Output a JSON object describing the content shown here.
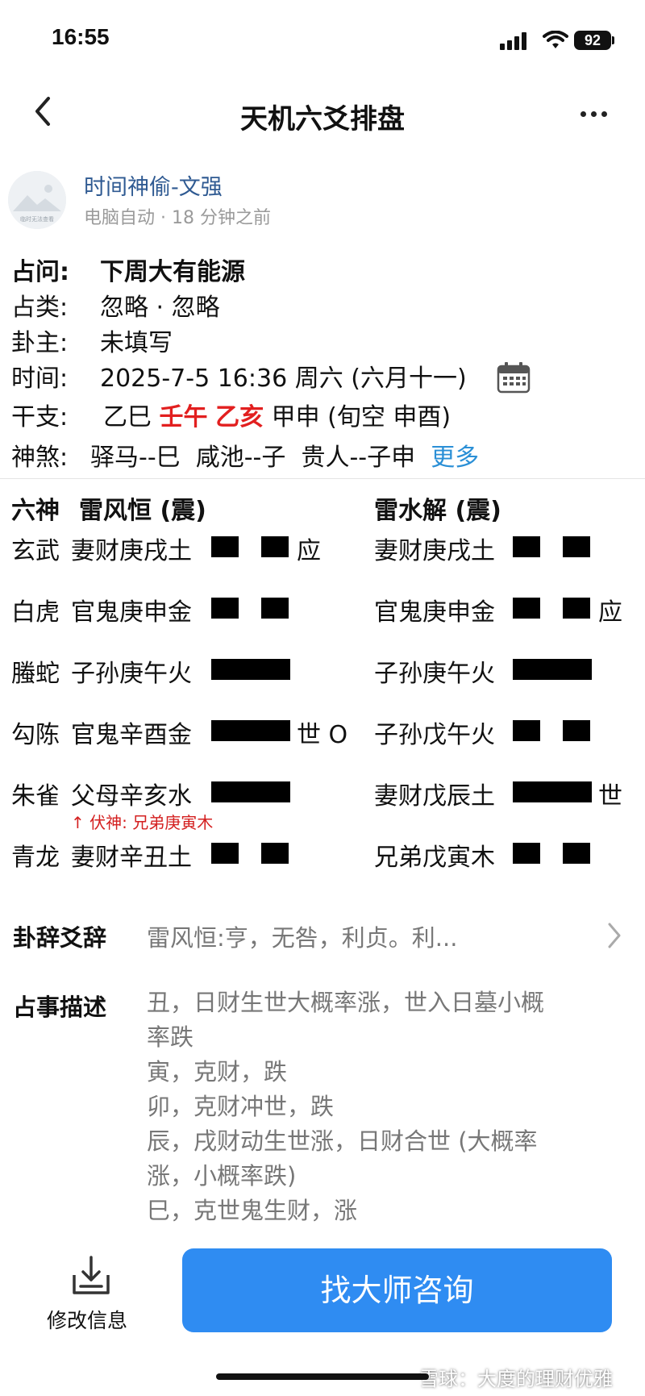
{
  "status_bar": {
    "time": "16:55",
    "battery": "92"
  },
  "nav": {
    "title": "天机六爻排盘"
  },
  "author": {
    "name": "时间神偷-文强",
    "meta": "电脑自动 · 18 分钟之前",
    "avatar_caption": "临时无法查看"
  },
  "info": {
    "question_label": "占问:",
    "question": "下周大有能源",
    "category_label": "占类:",
    "category": "忽略 · 忽略",
    "owner_label": "卦主:",
    "owner": "未填写",
    "time_label": "时间:",
    "time": "2025-7-5 16:36 周六 (六月十一)",
    "ganzhi_label": "干支:",
    "ganzhi_1": "乙巳",
    "ganzhi_2": "壬午",
    "ganzhi_3": "乙亥",
    "ganzhi_4": "甲申 (旬空 申酉)",
    "shensha_label": "神煞:",
    "shensha": "驿马--巳  咸池--子  贵人--子申",
    "shensha_more": "更多"
  },
  "hexagram": {
    "header_liushen": "六神",
    "main_name": "雷风恒 (震)",
    "changed_name": "雷水解 (震)",
    "rows": [
      {
        "shen": "玄武",
        "main": "妻财庚戌土",
        "main_yao": "yin",
        "main_mark": "应",
        "changed": "妻财庚戌土",
        "changed_yao": "yin",
        "changed_mark": ""
      },
      {
        "shen": "白虎",
        "main": "官鬼庚申金",
        "main_yao": "yin",
        "main_mark": "",
        "changed": "官鬼庚申金",
        "changed_yao": "yin",
        "changed_mark": "应"
      },
      {
        "shen": "螣蛇",
        "main": "子孙庚午火",
        "main_yao": "yang",
        "main_mark": "",
        "changed": "子孙庚午火",
        "changed_yao": "yang",
        "changed_mark": ""
      },
      {
        "shen": "勾陈",
        "main": "官鬼辛酉金",
        "main_yao": "yang",
        "main_mark": "世 O",
        "changed": "子孙戊午火",
        "changed_yao": "yin",
        "changed_mark": ""
      },
      {
        "shen": "朱雀",
        "main": "父母辛亥水",
        "main_yao": "yang",
        "main_mark": "",
        "changed": "妻财戊辰土",
        "changed_yao": "yang",
        "changed_mark": "世"
      },
      {
        "shen": "青龙",
        "main": "妻财辛丑土",
        "main_yao": "yin",
        "main_mark": "",
        "changed": "兄弟戊寅木",
        "changed_yao": "yin",
        "changed_mark": ""
      }
    ],
    "fushen_note": "↑ 伏神: 兄弟庚寅木"
  },
  "guaci": {
    "label": "卦辞爻辞",
    "preview": "雷风恒:亨，无咎，利贞。利..."
  },
  "description": {
    "label": "占事描述",
    "lines": [
      "丑，日财生世大概率涨，世入日墓小概",
      "率跌",
      "寅，克财，跌",
      "卯，克财冲世，跌",
      "辰，戌财动生世涨，日财合世 (大概率",
      "涨，小概率跌)",
      "巳，克世鬼生财，涨"
    ]
  },
  "bottom": {
    "edit_label": "修改信息",
    "cta_label": "找大师咨询"
  },
  "watermark": "雪球：大度的理财优雅"
}
